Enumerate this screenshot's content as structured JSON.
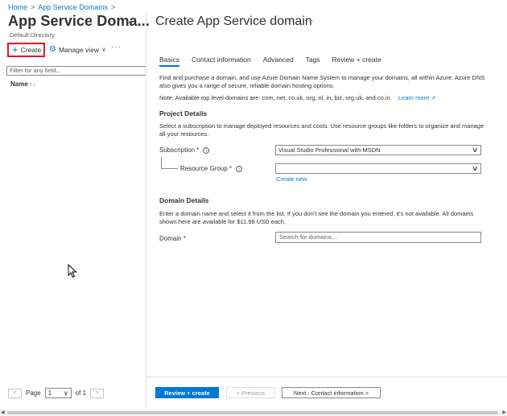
{
  "breadcrumb": {
    "items": [
      "Home",
      "App Service Domains"
    ],
    "separator": ">"
  },
  "left_panel": {
    "title": "App Service Doma...",
    "subtitle": "Default Directory",
    "collapse_glyph": "«",
    "toolbar": {
      "create_label": "Create",
      "manage_view_label": "Manage view",
      "more_glyph": "···"
    },
    "filter_placeholder": "Filter for any field...",
    "column_header": "Name",
    "sort_glyph": "↑↓",
    "pager": {
      "prev_glyph": "<",
      "page_label": "Page",
      "page_value": "1",
      "of_label": "of 1",
      "next_glyph": ">"
    }
  },
  "main": {
    "title": "Create App Service domain",
    "more_glyph": "···",
    "tabs": [
      {
        "label": "Basics",
        "active": true
      },
      {
        "label": "Contact information",
        "active": false
      },
      {
        "label": "Advanced",
        "active": false
      },
      {
        "label": "Tags",
        "active": false
      },
      {
        "label": "Review + create",
        "active": false
      }
    ],
    "intro": "Find and purchase a domain, and use Azure Domain Name System to manage your domains, all within Azure. Azure DNS also gives you a range of secure, reliable domain hosting options.",
    "note": "Note: Available top level domains are: com, net, co.uk, org, nl, in, biz, org.uk, and co.in.",
    "learn_more": "Learn more",
    "project_details": {
      "heading": "Project Details",
      "description": "Select a subscription to manage deployed resources and costs. Use resource groups like folders to organize and manage all your resources.",
      "subscription_label": "Subscription *",
      "subscription_value": "Visual Studio Professional with MSDN",
      "resource_group_label": "Resource Group *",
      "resource_group_value": "",
      "create_new": "Create new"
    },
    "domain_details": {
      "heading": "Domain Details",
      "description": "Enter a domain name and select it from the list. If you don't see the domain you entered, it's not available. All domains shown here are available for $11.99 USD each.",
      "domain_label": "Domain *",
      "domain_placeholder": "Search for domains..."
    }
  },
  "footer": {
    "review_create": "Review + create",
    "previous": "< Previous",
    "next": "Next : Contact information >"
  },
  "icons": {
    "plus": "plus-icon",
    "gear": "gear-icon",
    "info": "info-icon",
    "external_link": "external-link-icon",
    "chevron": "chevron-down-icon",
    "cursor": "mouse-pointer-icon"
  },
  "colors": {
    "accent": "#0078d4",
    "highlight_border": "#e81123"
  }
}
